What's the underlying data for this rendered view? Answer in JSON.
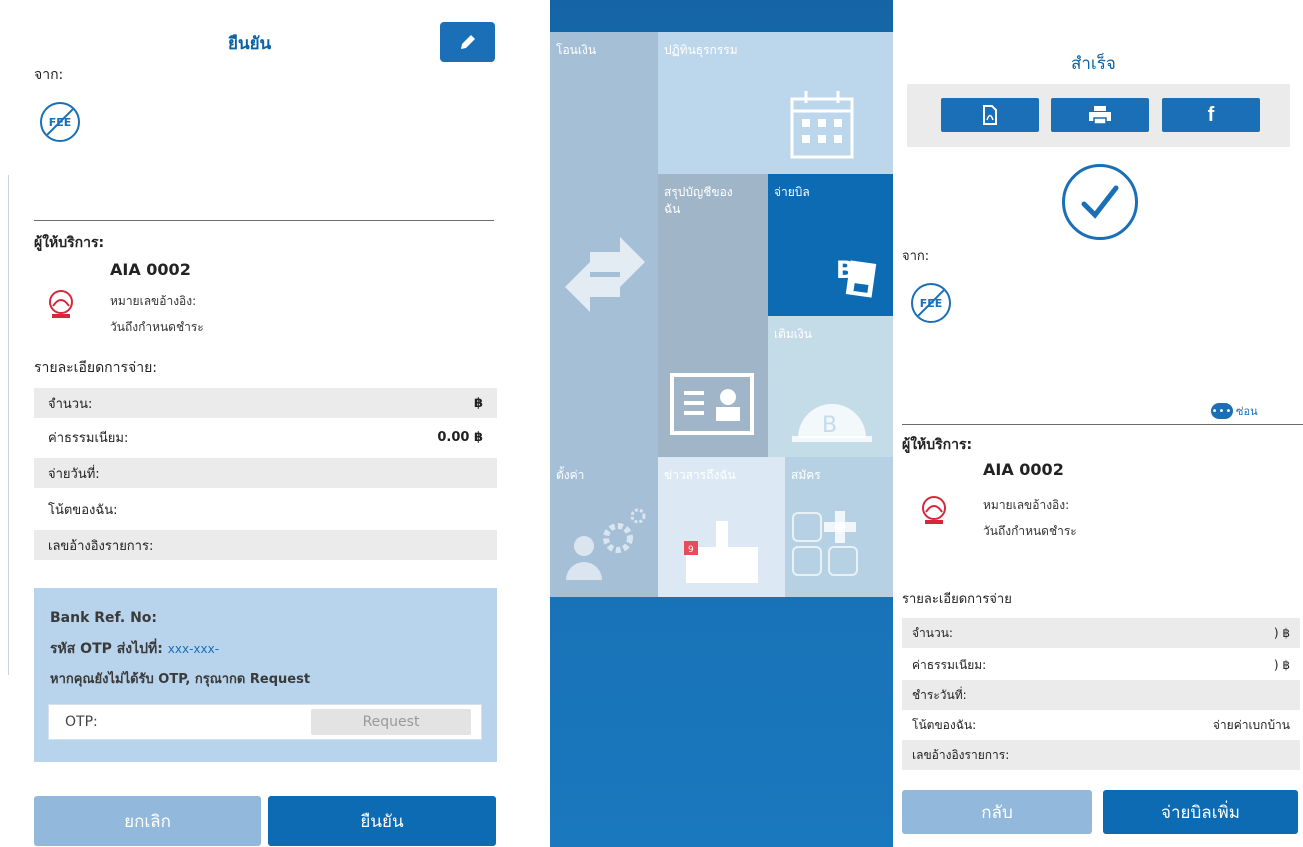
{
  "confirm_screen": {
    "title": "ยืนยัน",
    "from_label": "จาก:",
    "fee_icon_text": "FEE",
    "provider_label": "ผู้ให้บริการ:",
    "provider_name": "AIA 0002",
    "ref_label": "หมายเลขอ้างอิง:",
    "due_label": "วันถึงกำหนดชำระ",
    "details_label": "รายละเอียดการจ่าย:",
    "rows": [
      {
        "label": "จำนวน:",
        "value": "฿"
      },
      {
        "label": "ค่าธรรมเนียม:",
        "value": "0.00 ฿"
      },
      {
        "label": "จ่ายวันที่:",
        "value": ""
      },
      {
        "label": "โน้ตของฉัน:",
        "value": ""
      },
      {
        "label": "เลขอ้างอิงรายการ:",
        "value": ""
      }
    ],
    "otp": {
      "bank_ref": "Bank Ref. No:",
      "sent_to_label": "รหัส OTP ส่งไปที่:",
      "sent_to_value": "xxx-xxx-",
      "hint": "หากคุณยังไม่ได้รับ OTP, กรุณากด Request",
      "field_label": "OTP:",
      "request_label": "Request"
    },
    "cancel_label": "ยกเลิก",
    "confirm_label": "ยืนยัน"
  },
  "menu": {
    "tiles": [
      {
        "label": "โอนเงิน",
        "icon": "transfer-arrows-icon"
      },
      {
        "label": "ปฏิทินธุรกรรม",
        "icon": "calendar-icon"
      },
      {
        "label": "สรุปบัญชีของฉัน",
        "icon": "id-card-icon"
      },
      {
        "label": "จ่ายบิล",
        "icon": "bill-icon"
      },
      {
        "label": "เติมเงิน",
        "icon": "topup-icon"
      },
      {
        "label": "ตั้งค่า",
        "icon": "settings-icon"
      },
      {
        "label": "ข่าวสารถึงฉัน",
        "icon": "inbox-icon"
      },
      {
        "label": "สมัคร",
        "icon": "apply-icon"
      }
    ]
  },
  "success_screen": {
    "title": "สำเร็จ",
    "share_buttons": [
      "pdf-icon",
      "print-icon",
      "facebook-icon"
    ],
    "facebook_glyph": "f",
    "from_label": "จาก:",
    "fee_icon_text": "FEE",
    "more_label": "ซ่อน",
    "provider_label": "ผู้ให้บริการ:",
    "provider_name": "AIA 0002",
    "ref_label": "หมายเลขอ้างอิง:",
    "due_label": "วันถึงกำหนดชำระ",
    "details_label": "รายละเอียดการจ่าย",
    "rows": [
      {
        "label": "จำนวน:",
        "value": ") ฿"
      },
      {
        "label": "ค่าธรรมเนียม:",
        "value": ") ฿"
      },
      {
        "label": "ชำระวันที่:",
        "value": ""
      },
      {
        "label": "โน้ตของฉัน:",
        "value": "จ่ายค่าเบกบ้าน"
      },
      {
        "label": "เลขอ้างอิงรายการ:",
        "value": ""
      }
    ],
    "back_label": "กลับ",
    "pay_more_label": "จ่ายบิลเพิ่ม"
  },
  "colors": {
    "brand_blue": "#1a6fb6",
    "dark_blue": "#0d6bb3",
    "light_blue": "#92b9dc",
    "otp_bg": "#b8d4ec",
    "row_shade": "#ebebeb"
  }
}
